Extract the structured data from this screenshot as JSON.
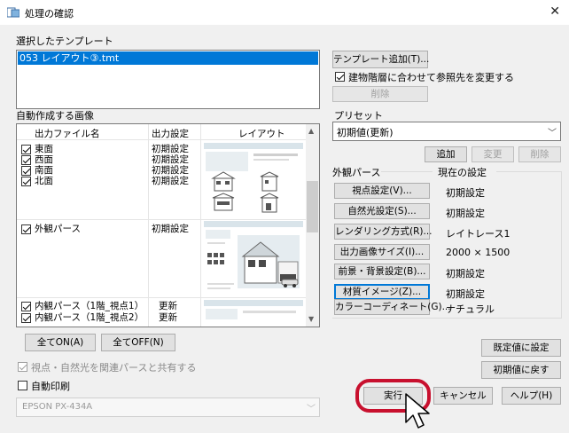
{
  "window": {
    "title": "処理の確認"
  },
  "template_section": {
    "label": "選択したテンプレート",
    "selected_item": "053 レイアウト③.tmt",
    "add_button": "テンプレート追加(T)...",
    "follow_checkbox_label": "建物階層に合わせて参照先を変更する",
    "follow_checked": true,
    "delete_button": "削除"
  },
  "auto_images": {
    "label": "自動作成する画像",
    "columns": [
      "出力ファイル名",
      "出力設定",
      "レイアウト"
    ],
    "rows": [
      {
        "name": "東面",
        "setting": "初期設定",
        "checked": true
      },
      {
        "name": "西面",
        "setting": "初期設定",
        "checked": true
      },
      {
        "name": "南面",
        "setting": "初期設定",
        "checked": true
      },
      {
        "name": "北面",
        "setting": "初期設定",
        "checked": true
      },
      {
        "name": "外観パース",
        "setting": "初期設定",
        "checked": true
      },
      {
        "name": "内観パース（1階_視点1）",
        "setting": "更新",
        "checked": true
      },
      {
        "name": "内観パース（1階_視点2）",
        "setting": "更新",
        "checked": true
      }
    ],
    "all_on_button": "全てON(A)",
    "all_off_button": "全てOFF(N)",
    "share_checkbox_label": "視点・自然光を関連パースと共有する",
    "share_checked": true,
    "auto_print_label": "自動印刷",
    "auto_print_checked": false,
    "printer": "EPSON PX-434A"
  },
  "preset": {
    "label": "プリセット",
    "value": "初期値(更新)",
    "add_button": "追加",
    "change_button": "変更",
    "delete_button": "削除"
  },
  "exterior": {
    "group_label": "外観パース",
    "current_label": "現在の設定",
    "items": [
      {
        "button": "視点設定(V)...",
        "value": "初期設定"
      },
      {
        "button": "自然光設定(S)...",
        "value": "初期設定"
      },
      {
        "button": "レンダリング方式(R)...",
        "value": "レイトレース1"
      },
      {
        "button": "出力画像サイズ(I)...",
        "value": "2000 × 1500"
      },
      {
        "button": "前景・背景設定(B)...",
        "value": "初期設定"
      },
      {
        "button": "材質イメージ(Z)...",
        "value": "初期設定"
      },
      {
        "button": "カラーコーディネート(G)...",
        "value": "ナチュラル"
      }
    ]
  },
  "footer": {
    "default_set_button": "既定値に設定",
    "reset_button": "初期値に戻す",
    "run_button": "実行",
    "cancel_button": "キャンセル",
    "help_button": "ヘルプ(H)"
  },
  "colors": {
    "selection": "#0078d7",
    "highlight_ring": "#c8102e",
    "thumb_panel": "#e8eef1",
    "house_dark": "#4a4a4a"
  }
}
